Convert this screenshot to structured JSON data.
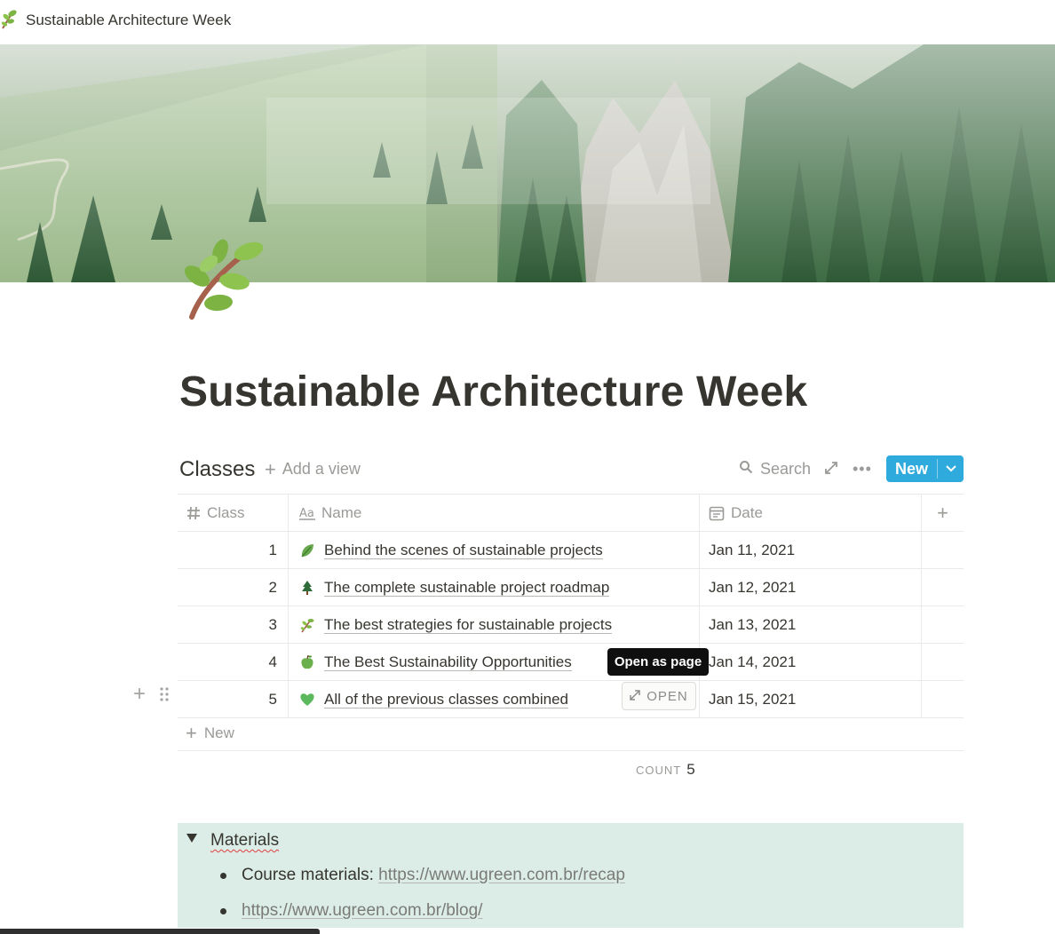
{
  "window": {
    "title": "Sustainable Architecture Week",
    "icon": "herb-icon"
  },
  "page": {
    "title": "Sustainable Architecture Week",
    "icon": "herb-icon",
    "cover": "misty-forest-mountain-cover"
  },
  "database": {
    "title": "Classes",
    "add_view_label": "Add a view",
    "search_label": "Search",
    "new_button_label": "New",
    "columns": [
      {
        "label": "Class",
        "icon": "hash-icon"
      },
      {
        "label": "Name",
        "icon": "text-aa-icon"
      },
      {
        "label": "Date",
        "icon": "calendar-icon"
      }
    ],
    "rows": [
      {
        "class": "1",
        "name": "Behind the scenes of sustainable projects",
        "date": "Jan 11, 2021",
        "emoji": "leafy-green-icon"
      },
      {
        "class": "2",
        "name": "The complete sustainable project roadmap",
        "date": "Jan 12, 2021",
        "emoji": "evergreen-tree-icon"
      },
      {
        "class": "3",
        "name": "The best strategies for sustainable projects",
        "date": "Jan 13, 2021",
        "emoji": "herb-icon"
      },
      {
        "class": "4",
        "name": "The Best Sustainability Opportunities",
        "date": "Jan 14, 2021",
        "emoji": "green-apple-icon"
      },
      {
        "class": "5",
        "name": "All of the previous classes combined",
        "date": "Jan 15, 2021",
        "emoji": "green-heart-icon"
      }
    ],
    "tooltip": "Open as page",
    "open_button_label": "OPEN",
    "new_row_label": "New",
    "count_label": "COUNT",
    "count_value": "5"
  },
  "materials": {
    "title": "Materials",
    "items": [
      {
        "prefix": "Course materials: ",
        "link": "https://www.ugreen.com.br/recap"
      },
      {
        "prefix": "",
        "link": "https://www.ugreen.com.br/blog/"
      }
    ]
  },
  "colors": {
    "accent": "#2eaadc",
    "toggle_background": "#dcede8",
    "text": "#37352f",
    "muted": "#9b9a97"
  }
}
